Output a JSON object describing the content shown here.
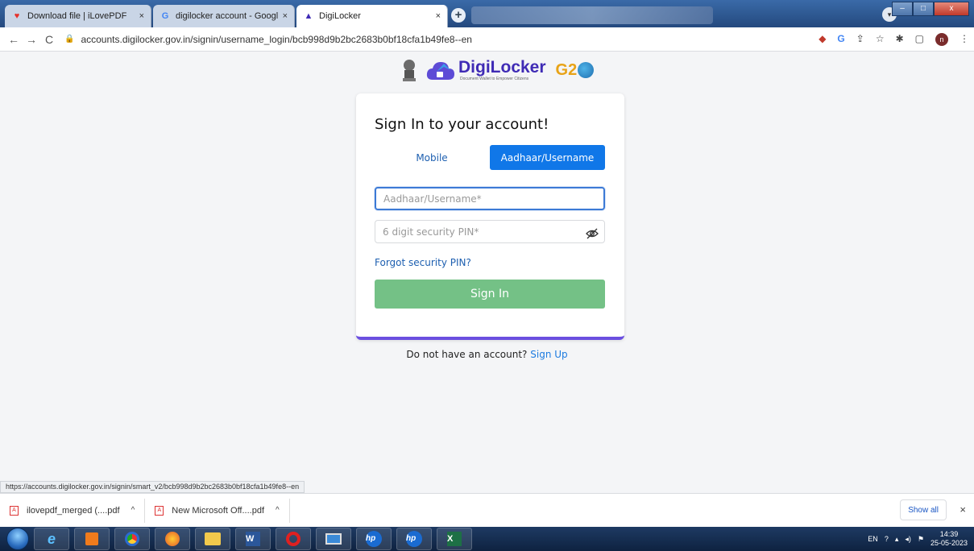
{
  "browser": {
    "tabs": [
      {
        "title": "Download file | iLovePDF",
        "close": "×"
      },
      {
        "title": "digilocker account - Google Sear",
        "close": "×"
      },
      {
        "title": "DigiLocker",
        "close": "×"
      }
    ],
    "new_tab": "+",
    "url": "accounts.digilocker.gov.in/signin/username_login/bcb998d9b2bc2683b0bf18cfa1b49fe8--en",
    "back": "←",
    "forward": "→",
    "reload": "C"
  },
  "page": {
    "brand_name": "DigiLocker",
    "brand_tagline": "Document Wallet to Empower Citizens",
    "g20_text": "G2",
    "heading": "Sign In to your account!",
    "tabs": {
      "mobile": "Mobile",
      "aadhaar": "Aadhaar/Username"
    },
    "username_placeholder": "Aadhaar/Username*",
    "pin_placeholder": "6 digit security PIN*",
    "forgot_link": "Forgot security PIN?",
    "sign_in_button": "Sign In",
    "no_account_text": "Do not have an account?",
    "sign_up_link": "Sign Up"
  },
  "status_url": "https://accounts.digilocker.gov.in/signin/smart_v2/bcb998d9b2bc2683b0bf18cfa1b49fe8--en",
  "downloads": {
    "items": [
      {
        "name": "ilovepdf_merged (....pdf"
      },
      {
        "name": "New Microsoft Off....pdf"
      }
    ],
    "show_all": "Show all",
    "close": "×"
  },
  "taskbar": {
    "lang": "EN",
    "time": "14:39",
    "date": "25-05-2023"
  },
  "colors": {
    "primary_blue": "#1077e8",
    "sign_in_green": "#74c186",
    "brand_purple": "#3f2bb5",
    "card_accent": "#6b4fe0"
  }
}
